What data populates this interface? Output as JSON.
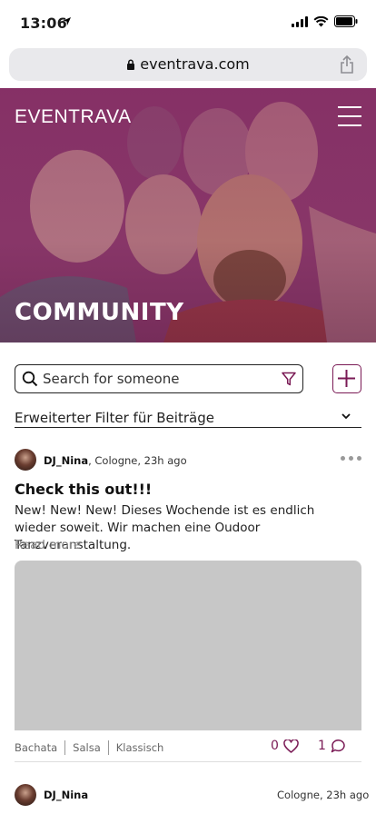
{
  "status_bar": {
    "time": "13:06"
  },
  "browser": {
    "url": "eventrava.com"
  },
  "header": {
    "logo": "EVENTRAVA",
    "page_title": "COMMUNITY"
  },
  "search": {
    "placeholder": "Search for someone"
  },
  "advanced_filter": {
    "label": "Erweiterter Filter für Beiträge"
  },
  "posts": [
    {
      "author": "DJ_Nina",
      "meta": ", Cologne, 23h ago",
      "title": "Check this out!!!",
      "body": "New! New! New! Dieses Wochende ist es endlich wieder soweit. Wir machen eine Oudoor Tanzveranstaltung.",
      "read_more": "Read more",
      "tags": [
        "Bachata",
        "Salsa",
        "Klassisch"
      ],
      "likes": "0",
      "comments": "1"
    },
    {
      "author": "DJ_Nina",
      "meta": "Cologne, 23h ago"
    }
  ],
  "colors": {
    "brand": "#7a1a55",
    "hero_tint": "#8a2a66",
    "image_placeholder": "#c7c7c7"
  }
}
